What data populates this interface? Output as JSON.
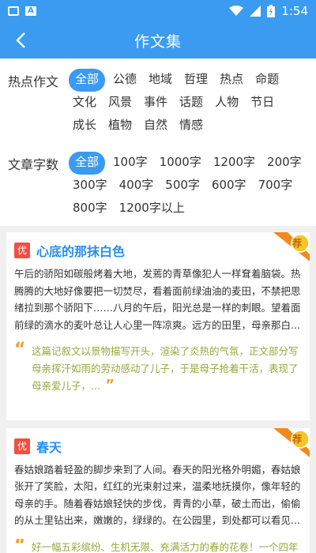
{
  "status_bar": {
    "time": "1:54",
    "icons": [
      "image-icon",
      "a-icon",
      "wifi-icon",
      "signal-icon",
      "battery-charging-icon"
    ]
  },
  "header": {
    "title": "作文集",
    "back_icon": "chevron-left-icon"
  },
  "filters": {
    "topic": {
      "label": "热点作文",
      "options": [
        "全部",
        "公德",
        "地域",
        "哲理",
        "热点",
        "命题",
        "文化",
        "风景",
        "事件",
        "话题",
        "人物",
        "节日",
        "成长",
        "植物",
        "自然",
        "情感"
      ],
      "selected": "全部"
    },
    "length": {
      "label": "文章字数",
      "options": [
        "全部",
        "100字",
        "1000字",
        "1200字",
        "200字",
        "300字",
        "400字",
        "500字",
        "600字",
        "700字",
        "800字",
        "1200字以上"
      ],
      "selected": "全部"
    }
  },
  "articles": [
    {
      "badge": "优",
      "title": "心底的那抹白色",
      "ribbon": "荐",
      "excerpt": "午后的骄阳如碳般烤着大地，发蔫的青草像犯人一样耷着脑袋。热腾腾的大地好像要把一切焚尽，看着面前绿油油的麦田，不禁把思绪拉到那个骄阳下……八月的午后，阳光总是一样的刺眼。望着面前绿的滴水的麦叶总让人心里一阵凉爽。远方的田里，母亲那白...",
      "comment": "这篇记叙文以景物描写开头，渲染了炎热的气氛，正文部分写母亲挥汗如雨的劳动感动了儿子，于是母子抢着干活，表现了母亲爱儿子，..."
    },
    {
      "badge": "优",
      "title": "春天",
      "ribbon": "荐",
      "excerpt": "春姑娘踏着轻盈的脚步来到了人间。春天的阳光格外明媚，春姑娘张开了笑脸，太阳，红红的光束射过来，温柔地抚摸你，像年轻的母亲的手。随着春姑娘轻快的步伐，青青的小草，破土而出，偷偷的从土里钻出来，嫩嫩的，绿绿的。在公园里，到处都可以看见...",
      "comment": "好一幅五彩缤纷、生机无限、充满活力的春的花卷！一个四年"
    }
  ]
}
